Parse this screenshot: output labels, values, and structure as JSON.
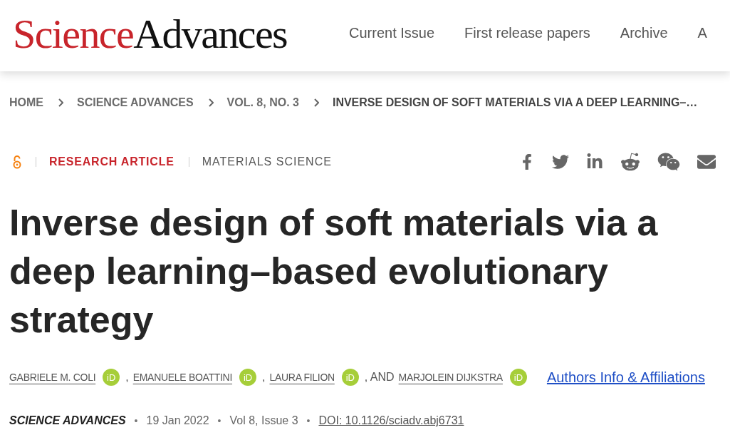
{
  "header": {
    "logo": {
      "part_1": "Science",
      "part_2": "Advances"
    },
    "nav": [
      "Current Issue",
      "First release papers",
      "Archive",
      "A"
    ]
  },
  "breadcrumb": [
    {
      "label": "HOME",
      "current": false
    },
    {
      "label": "SCIENCE ADVANCES",
      "current": false
    },
    {
      "label": "VOL. 8, NO. 3",
      "current": false
    },
    {
      "label": "INVERSE DESIGN OF SOFT MATERIALS VIA A DEEP LEARNING–…",
      "current": true
    }
  ],
  "article": {
    "open_access": true,
    "type": "RESEARCH ARTICLE",
    "subject": "MATERIALS SCIENCE",
    "title": "Inverse design of soft materials via a deep learning–based evolutionary strategy",
    "authors": [
      {
        "name": "GABRIELE M. COLI",
        "orcid": "iD"
      },
      {
        "separator": ",",
        "name": "EMANUELE BOATTINI",
        "orcid": "iD"
      },
      {
        "separator": ",",
        "name": "LAURA FILION",
        "orcid": "iD"
      },
      {
        "separator": ", AND",
        "name": "MARJOLEIN DIJKSTRA",
        "orcid": "iD"
      }
    ],
    "authors_link": "Authors Info & Affiliations",
    "citation": [
      {
        "kind": "journal",
        "text": "SCIENCE ADVANCES"
      },
      {
        "kind": "plain",
        "separator": "•",
        "text": "19 Jan 2022"
      },
      {
        "kind": "plain",
        "separator": "•",
        "text": "Vol 8, Issue 3"
      },
      {
        "kind": "link",
        "separator": "•",
        "text": "DOI: 10.1126/sciadv.abj6731"
      }
    ]
  }
}
